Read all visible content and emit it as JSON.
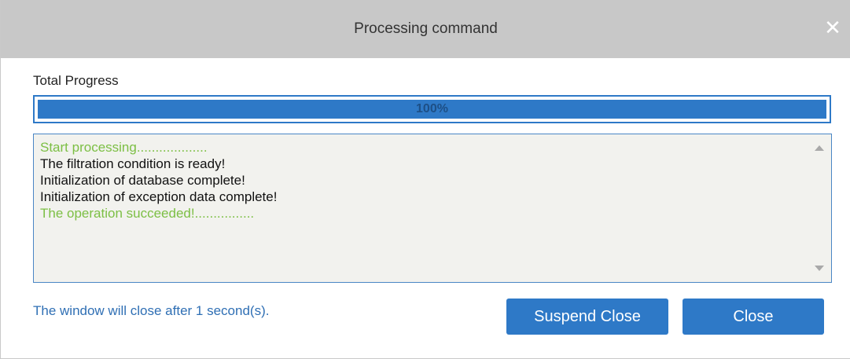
{
  "dialog": {
    "title": "Processing command",
    "close_icon": "close-icon",
    "close_glyph": "✕"
  },
  "progress": {
    "label": "Total Progress",
    "percent_text": "100%",
    "value": 1.0,
    "fill_color": "#2e79c7"
  },
  "log": {
    "lines": [
      {
        "text": "Start processing...................",
        "color": "green"
      },
      {
        "text": "The filtration condition is ready!",
        "color": "black"
      },
      {
        "text": "Initialization of database complete!",
        "color": "black"
      },
      {
        "text": "Initialization of exception data complete!",
        "color": "black"
      },
      {
        "text": "The operation succeeded!................",
        "color": "green"
      }
    ]
  },
  "footer": {
    "status_text": "The window will close after 1 second(s).",
    "suspend_label": "Suspend Close",
    "close_label": "Close"
  },
  "colors": {
    "accent": "#2e79c7",
    "title_bar": "#c8c8c8",
    "log_success": "#7cbf44",
    "status_text": "#2f6fb4"
  }
}
